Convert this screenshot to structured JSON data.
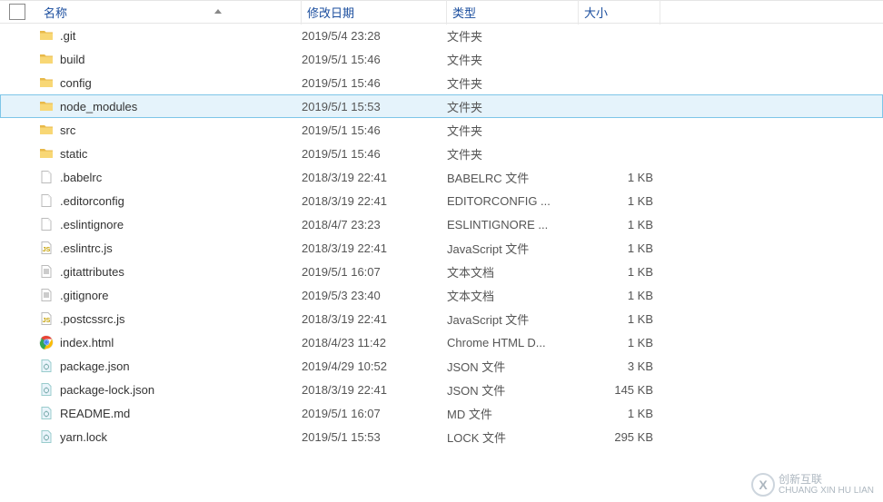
{
  "columns": {
    "name": "名称",
    "date": "修改日期",
    "type": "类型",
    "size": "大小"
  },
  "rows": [
    {
      "icon": "folder",
      "name": ".git",
      "date": "2019/5/4 23:28",
      "type": "文件夹",
      "size": "",
      "selected": false
    },
    {
      "icon": "folder",
      "name": "build",
      "date": "2019/5/1 15:46",
      "type": "文件夹",
      "size": "",
      "selected": false
    },
    {
      "icon": "folder",
      "name": "config",
      "date": "2019/5/1 15:46",
      "type": "文件夹",
      "size": "",
      "selected": false
    },
    {
      "icon": "folder",
      "name": "node_modules",
      "date": "2019/5/1 15:53",
      "type": "文件夹",
      "size": "",
      "selected": true
    },
    {
      "icon": "folder",
      "name": "src",
      "date": "2019/5/1 15:46",
      "type": "文件夹",
      "size": "",
      "selected": false
    },
    {
      "icon": "folder",
      "name": "static",
      "date": "2019/5/1 15:46",
      "type": "文件夹",
      "size": "",
      "selected": false
    },
    {
      "icon": "file",
      "name": ".babelrc",
      "date": "2018/3/19 22:41",
      "type": "BABELRC 文件",
      "size": "1 KB",
      "selected": false
    },
    {
      "icon": "file",
      "name": ".editorconfig",
      "date": "2018/3/19 22:41",
      "type": "EDITORCONFIG ...",
      "size": "1 KB",
      "selected": false
    },
    {
      "icon": "file",
      "name": ".eslintignore",
      "date": "2018/4/7 23:23",
      "type": "ESLINTIGNORE ...",
      "size": "1 KB",
      "selected": false
    },
    {
      "icon": "js",
      "name": ".eslintrc.js",
      "date": "2018/3/19 22:41",
      "type": "JavaScript 文件",
      "size": "1 KB",
      "selected": false
    },
    {
      "icon": "txt",
      "name": ".gitattributes",
      "date": "2019/5/1 16:07",
      "type": "文本文档",
      "size": "1 KB",
      "selected": false
    },
    {
      "icon": "txt",
      "name": ".gitignore",
      "date": "2019/5/3 23:40",
      "type": "文本文档",
      "size": "1 KB",
      "selected": false
    },
    {
      "icon": "js",
      "name": ".postcssrc.js",
      "date": "2018/3/19 22:41",
      "type": "JavaScript 文件",
      "size": "1 KB",
      "selected": false
    },
    {
      "icon": "chrome",
      "name": "index.html",
      "date": "2018/4/23 11:42",
      "type": "Chrome HTML D...",
      "size": "1 KB",
      "selected": false
    },
    {
      "icon": "cfg",
      "name": "package.json",
      "date": "2019/4/29 10:52",
      "type": "JSON 文件",
      "size": "3 KB",
      "selected": false
    },
    {
      "icon": "cfg",
      "name": "package-lock.json",
      "date": "2018/3/19 22:41",
      "type": "JSON 文件",
      "size": "145 KB",
      "selected": false
    },
    {
      "icon": "cfg",
      "name": "README.md",
      "date": "2019/5/1 16:07",
      "type": "MD 文件",
      "size": "1 KB",
      "selected": false
    },
    {
      "icon": "cfg",
      "name": "yarn.lock",
      "date": "2019/5/1 15:53",
      "type": "LOCK 文件",
      "size": "295 KB",
      "selected": false
    }
  ],
  "watermark": {
    "logo": "X",
    "text1": "创新互联",
    "text2": "CHUANG XIN HU LIAN"
  }
}
